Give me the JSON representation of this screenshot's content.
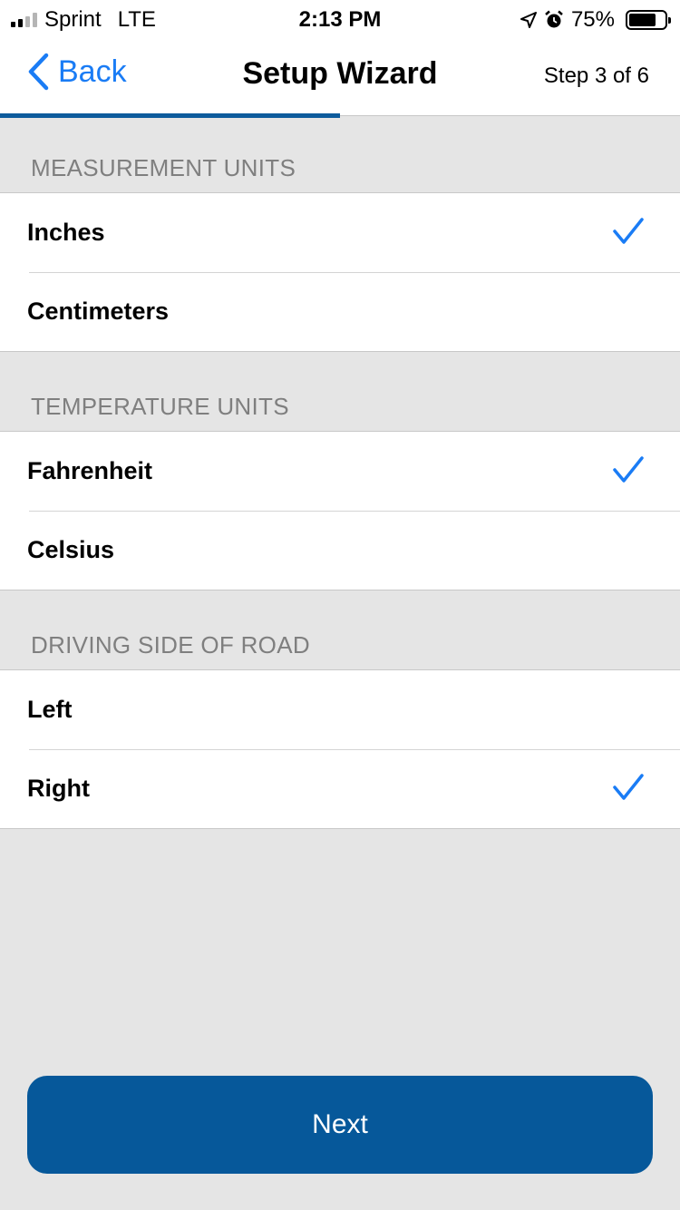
{
  "status_bar": {
    "carrier": "Sprint",
    "network": "LTE",
    "time": "2:13 PM",
    "battery_text": "75%",
    "battery_level": 0.75,
    "icons": [
      "signal-icon",
      "location-arrow-icon",
      "alarm-icon",
      "battery-icon"
    ]
  },
  "nav": {
    "back_label": "Back",
    "title": "Setup Wizard",
    "step_label": "Step 3 of 6",
    "progress": 0.5,
    "accent_color": "#1a7cf5",
    "progress_color": "#0d5b9c"
  },
  "sections": [
    {
      "header": "MEASUREMENT UNITS",
      "options": [
        {
          "label": "Inches",
          "selected": true
        },
        {
          "label": "Centimeters",
          "selected": false
        }
      ]
    },
    {
      "header": "TEMPERATURE UNITS",
      "options": [
        {
          "label": "Fahrenheit",
          "selected": true
        },
        {
          "label": "Celsius",
          "selected": false
        }
      ]
    },
    {
      "header": "DRIVING SIDE OF ROAD",
      "options": [
        {
          "label": "Left",
          "selected": false
        },
        {
          "label": "Right",
          "selected": true
        }
      ]
    }
  ],
  "footer": {
    "next_label": "Next",
    "button_color": "#06589a"
  }
}
